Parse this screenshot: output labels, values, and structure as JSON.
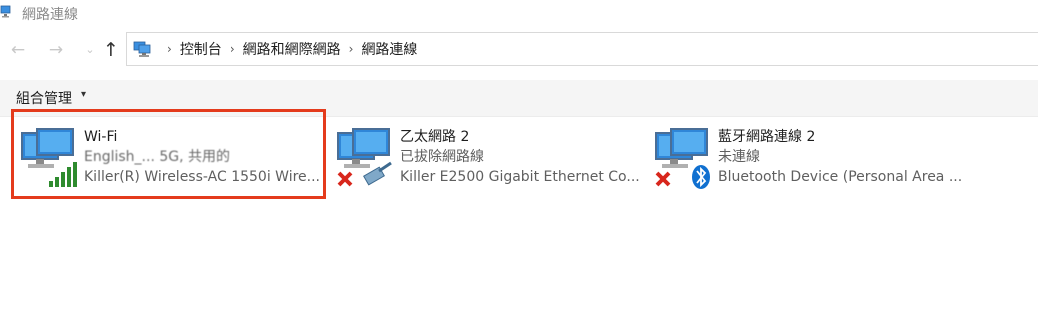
{
  "window": {
    "title": "網路連線"
  },
  "nav": {
    "back_glyph": "←",
    "forward_glyph": "→",
    "recent_glyph": "⌄",
    "up_glyph": "↑",
    "breadcrumbs": [
      "控制台",
      "網路和網際網路",
      "網路連線"
    ],
    "separator": "›"
  },
  "toolbar": {
    "organize_label": "組合管理",
    "organize_arrow": "▾"
  },
  "connections": [
    {
      "name": "Wi-Fi",
      "status": "English_... 5G, 共用的",
      "device": "Killer(R) Wireless-AC 1550i Wire...",
      "icon": "wifi-signal-icon",
      "selected": true
    },
    {
      "name": "乙太網路 2",
      "status": "已拔除網路線",
      "device": "Killer E2500 Gigabit Ethernet Co...",
      "icon": "ethernet-cable-icon",
      "disconnected": true
    },
    {
      "name": "藍牙網路連線 2",
      "status": "未連線",
      "device": "Bluetooth Device (Personal Area ...",
      "icon": "bluetooth-icon",
      "disconnected": true
    }
  ],
  "colors": {
    "highlight": "#e43b1c",
    "signal": "#2e8b2e",
    "error_x": "#d8261c",
    "bluetooth": "#1070d0"
  }
}
